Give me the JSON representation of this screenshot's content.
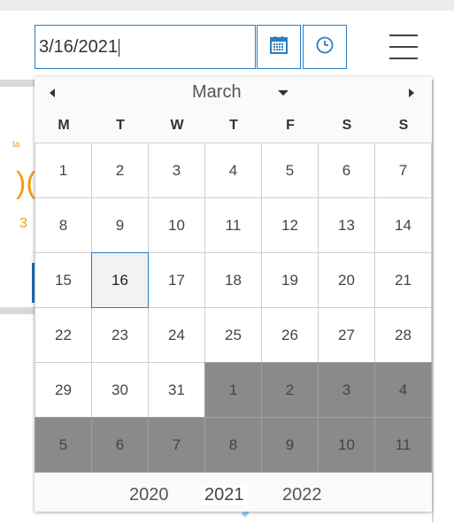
{
  "date_input": {
    "value": "3/16/2021"
  },
  "buttons": {
    "calendar_icon": "calendar-icon",
    "clock_icon": "clock-icon",
    "menu_icon": "hamburger-menu-icon"
  },
  "calendar": {
    "month": "March",
    "weekdays": [
      "M",
      "T",
      "W",
      "T",
      "F",
      "S",
      "S"
    ],
    "days": [
      {
        "label": "1",
        "other": false
      },
      {
        "label": "2",
        "other": false
      },
      {
        "label": "3",
        "other": false
      },
      {
        "label": "4",
        "other": false
      },
      {
        "label": "5",
        "other": false
      },
      {
        "label": "6",
        "other": false
      },
      {
        "label": "7",
        "other": false
      },
      {
        "label": "8",
        "other": false
      },
      {
        "label": "9",
        "other": false
      },
      {
        "label": "10",
        "other": false
      },
      {
        "label": "11",
        "other": false
      },
      {
        "label": "12",
        "other": false
      },
      {
        "label": "13",
        "other": false
      },
      {
        "label": "14",
        "other": false
      },
      {
        "label": "15",
        "other": false
      },
      {
        "label": "16",
        "other": false,
        "today": true
      },
      {
        "label": "17",
        "other": false
      },
      {
        "label": "18",
        "other": false
      },
      {
        "label": "19",
        "other": false
      },
      {
        "label": "20",
        "other": false
      },
      {
        "label": "21",
        "other": false
      },
      {
        "label": "22",
        "other": false
      },
      {
        "label": "23",
        "other": false
      },
      {
        "label": "24",
        "other": false
      },
      {
        "label": "25",
        "other": false
      },
      {
        "label": "26",
        "other": false
      },
      {
        "label": "27",
        "other": false
      },
      {
        "label": "28",
        "other": false
      },
      {
        "label": "29",
        "other": false
      },
      {
        "label": "30",
        "other": false
      },
      {
        "label": "31",
        "other": false
      },
      {
        "label": "1",
        "other": true
      },
      {
        "label": "2",
        "other": true
      },
      {
        "label": "3",
        "other": true
      },
      {
        "label": "4",
        "other": true
      },
      {
        "label": "5",
        "other": true
      },
      {
        "label": "6",
        "other": true
      },
      {
        "label": "7",
        "other": true
      },
      {
        "label": "8",
        "other": true
      },
      {
        "label": "9",
        "other": true
      },
      {
        "label": "10",
        "other": true
      },
      {
        "label": "11",
        "other": true
      }
    ],
    "years": [
      "2020",
      "2021",
      "2022"
    ],
    "selected_year": "2021"
  },
  "colors": {
    "accent": "#2a7dc2",
    "other_month": "#8a8a8a",
    "background_accent": "#f39c12"
  }
}
